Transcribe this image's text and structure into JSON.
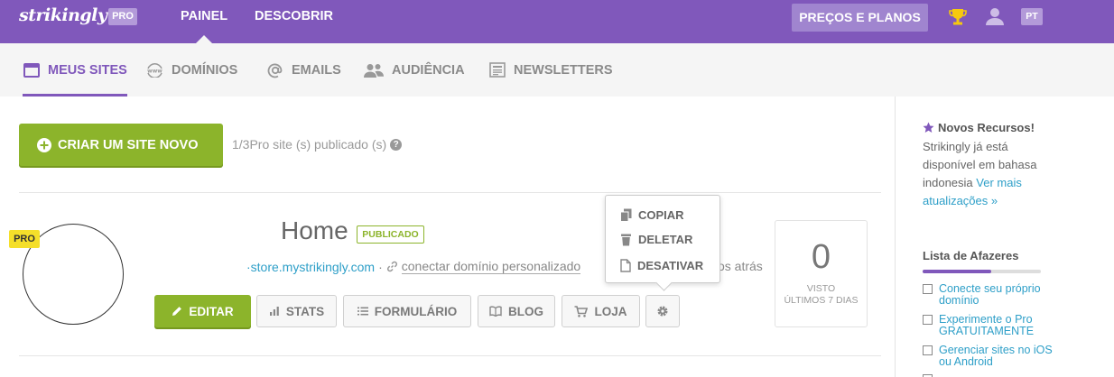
{
  "topbar": {
    "logo": "strikingly",
    "plan_badge": "PRO",
    "nav": [
      {
        "label": "PAINEL"
      },
      {
        "label": "DESCOBRIR"
      }
    ],
    "prices_button": "PREÇOS E PLANOS",
    "language": "PT",
    "brand_color": "#8058bb"
  },
  "subnav": {
    "tabs": [
      {
        "label": "MEUS SITES",
        "icon": "browser-window-icon"
      },
      {
        "label": "DOMÍNIOS",
        "icon": "www-globe-icon"
      },
      {
        "label": "EMAILS",
        "icon": "at-sign-icon"
      },
      {
        "label": "AUDIÊNCIA",
        "icon": "people-icon"
      },
      {
        "label": "NEWSLETTERS",
        "icon": "newspaper-icon"
      }
    ]
  },
  "main": {
    "create_button": "CRIAR UM SITE NOVO",
    "publish_count": "1/3Pro site (s) publicado (s)",
    "help_glyph": "?",
    "site": {
      "pro_tag": "PRO",
      "title": "Home",
      "status": "PUBLICADO",
      "url": "·store.mystrikingly.com",
      "separator": "·",
      "connect_domain": "conectar domínio personalizado",
      "updated_suffix": "os atrás",
      "actions": {
        "edit": "EDITAR",
        "stats": "STATS",
        "form": "FORMULÁRIO",
        "blog": "BLOG",
        "shop": "LOJA"
      },
      "menu": {
        "copy": "COPIAR",
        "delete": "DELETAR",
        "deactivate": "DESATIVAR"
      },
      "visits": {
        "count": "0",
        "label_line1": "VISTO",
        "label_line2": "ÚLTIMOS 7 DIAS"
      }
    },
    "accent_green": "#8cb42b"
  },
  "sidebar": {
    "new_features_title": "Novos Recursos!",
    "new_features_text": "Strikingly já está disponível em bahasa indonesia",
    "new_features_link": "Ver mais atualizações »",
    "todo_title": "Lista de Afazeres",
    "todo_progress": 0.58,
    "todo_items": [
      {
        "label": "Conecte seu próprio domínio"
      },
      {
        "label": "Experimente o Pro GRATUITAMENTE"
      },
      {
        "label": "Gerenciar sites no iOS ou Android"
      },
      {
        "label": ""
      }
    ]
  }
}
